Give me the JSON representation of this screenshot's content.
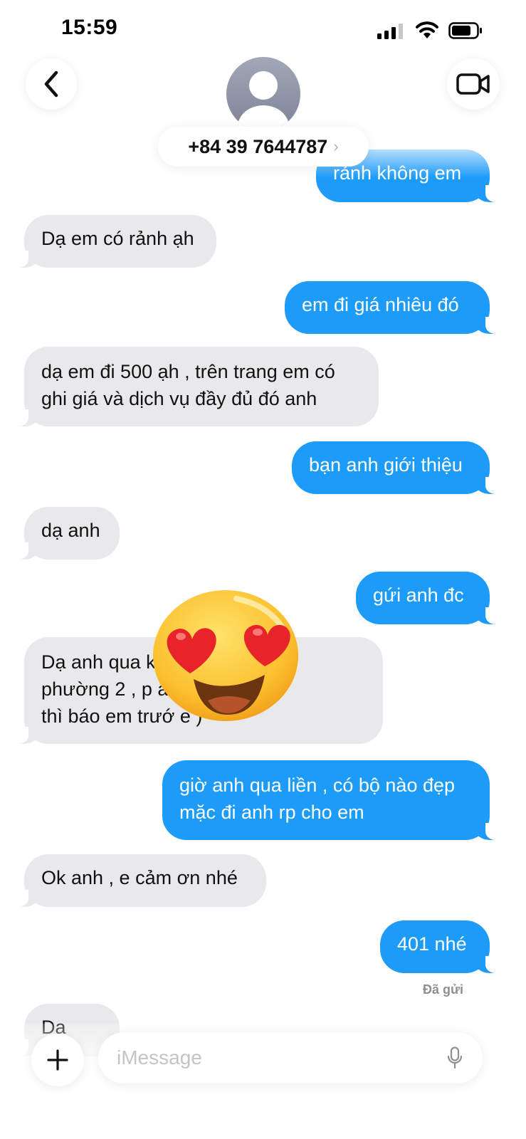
{
  "status_bar": {
    "time": "15:59"
  },
  "header": {
    "contact_name": "+84 39 7644787",
    "chevron": "›"
  },
  "icons": {
    "back": "chevron-left-icon",
    "video": "video-camera-icon",
    "avatar": "person-silhouette-icon",
    "plus": "plus-icon",
    "mic": "microphone-icon",
    "emoji": "heart-eyes-emoji-icon"
  },
  "messages": [
    {
      "direction": "outgoing",
      "text": "rảnh không em"
    },
    {
      "direction": "incoming",
      "text": "Dạ em có rảnh ạh"
    },
    {
      "direction": "outgoing",
      "text": "em đi giá nhiêu đó"
    },
    {
      "direction": "incoming",
      "text": "dạ em đi 500 ạh , trên trang em có\nghi giá và dịch vụ đầy đủ đó anh"
    },
    {
      "direction": "outgoing",
      "text": "bạn anh giới thiệu"
    },
    {
      "direction": "incoming",
      "text": "dạ anh"
    },
    {
      "direction": "outgoing",
      "text": "gứi anh đc"
    },
    {
      "direction": "incoming",
      "text": "Dạ anh qua k                    cù lao ,\nphường 2 , p                    anh qua\nthì báo em trướ                 e )"
    },
    {
      "direction": "outgoing",
      "text": "giờ anh qua liền , có bộ nào đẹp\nmặc đi anh rp cho em"
    },
    {
      "direction": "incoming",
      "text": "Ok anh , e cảm ơn nhé"
    },
    {
      "direction": "outgoing",
      "text": "401 nhé"
    },
    {
      "direction": "incoming",
      "text": "Dạ anh"
    }
  ],
  "delivery_status": "Đã gửi",
  "composer": {
    "placeholder": "iMessage"
  },
  "colors": {
    "outgoing_bubble": "#1c9bf9",
    "incoming_bubble": "#e9e9eb",
    "background": "#ffffff"
  }
}
